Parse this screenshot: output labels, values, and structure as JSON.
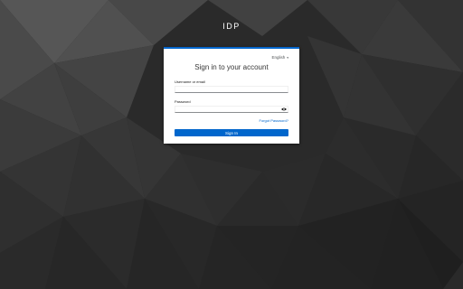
{
  "realm": {
    "title": "IDP"
  },
  "locale": {
    "current": "English"
  },
  "login": {
    "title": "Sign in to your account",
    "username_label": "Username or email",
    "username_value": "",
    "password_label": "Password",
    "password_value": "",
    "forgot_password": "Forgot Password?",
    "submit": "Sign In"
  },
  "icons": {
    "password_toggle": "eye-icon",
    "locale_dropdown": "chevron-down-icon"
  },
  "colors": {
    "accent": "#0066cc",
    "background": "#2b2b2b",
    "card": "#ffffff"
  }
}
